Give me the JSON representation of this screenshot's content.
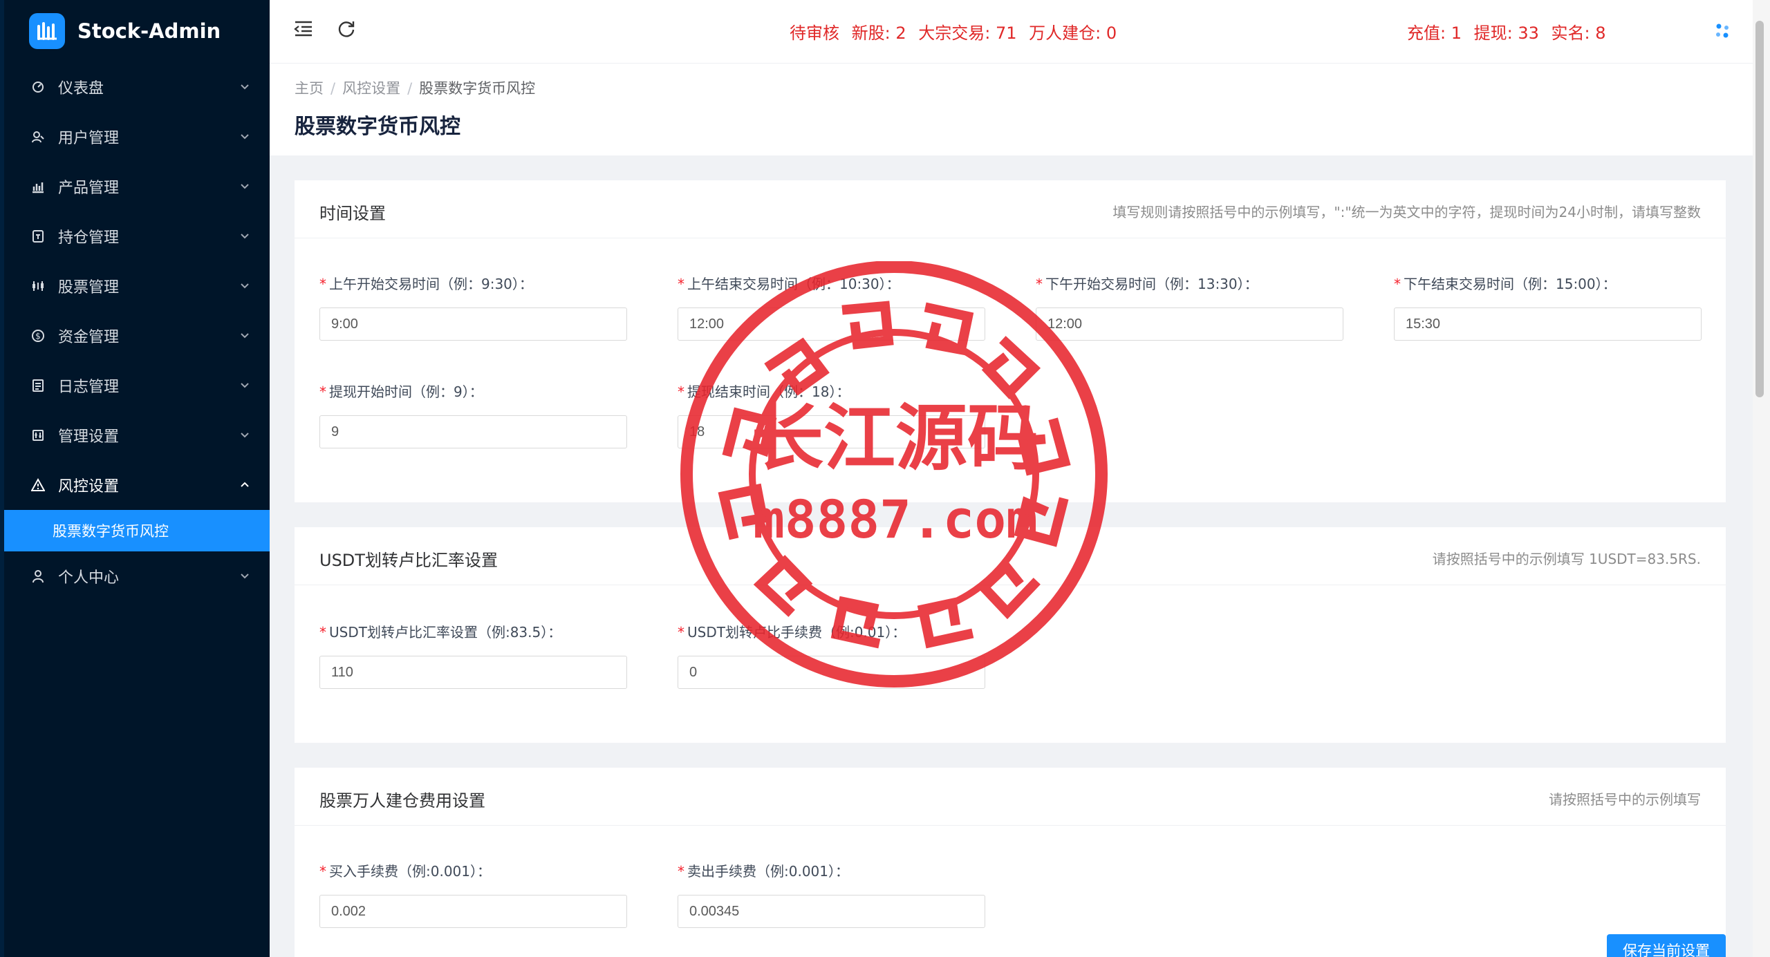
{
  "app": {
    "title": "Stock-Admin"
  },
  "sidebar": {
    "items": [
      {
        "label": "仪表盘",
        "icon": "dashboard-icon"
      },
      {
        "label": "用户管理",
        "icon": "users-icon"
      },
      {
        "label": "产品管理",
        "icon": "chart-icon"
      },
      {
        "label": "持仓管理",
        "icon": "wallet-icon"
      },
      {
        "label": "股票管理",
        "icon": "stock-icon"
      },
      {
        "label": "资金管理",
        "icon": "money-icon"
      },
      {
        "label": "日志管理",
        "icon": "log-icon"
      },
      {
        "label": "管理设置",
        "icon": "settings-icon"
      },
      {
        "label": "风控设置",
        "icon": "warning-icon",
        "expanded": true
      },
      {
        "label": "股票数字货币风控",
        "active": true
      },
      {
        "label": "个人中心",
        "icon": "user-icon"
      }
    ]
  },
  "header": {
    "stats_left": [
      "待审核",
      "新股: 2",
      "大宗交易: 71",
      "万人建仓: 0"
    ],
    "stats_right": [
      "充值: 1",
      "提现: 33",
      "实名: 8"
    ],
    "stat_color": "#e02828"
  },
  "breadcrumb": [
    "主页",
    "风控设置",
    "股票数字货币风控"
  ],
  "page_title": "股票数字货币风控",
  "sections": [
    {
      "title": "时间设置",
      "hint": "填写规则请按照括号中的示例填写，\":\"统一为英文中的字符，提现时间为24小时制，请填写整数",
      "fields": [
        {
          "label": "上午开始交易时间（例：9:30）：",
          "value": "9:00"
        },
        {
          "label": "上午结束交易时间（例：10:30）：",
          "value": "12:00"
        },
        {
          "label": "下午开始交易时间（例：13:30）：",
          "value": "12:00"
        },
        {
          "label": "下午结束交易时间（例：15:00）：",
          "value": "15:30"
        },
        {
          "label": "提现开始时间（例：9）：",
          "value": "9"
        },
        {
          "label": "提现结束时间（例：18）：",
          "value": "18"
        }
      ]
    },
    {
      "title": "USDT划转卢比汇率设置",
      "hint": "请按照括号中的示例填写 1USDT=83.5RS.",
      "fields": [
        {
          "label": "USDT划转卢比汇率设置（例:83.5）：",
          "value": "110"
        },
        {
          "label": "USDT划转卢比手续费（例:0.01）：",
          "value": "0"
        }
      ]
    },
    {
      "title": "股票万人建仓费用设置",
      "hint": "请按照括号中的示例填写",
      "fields": [
        {
          "label": "买入手续费（例:0.001）：",
          "value": "0.002"
        },
        {
          "label": "卖出手续费（例:0.001）：",
          "value": "0.00345"
        }
      ]
    }
  ],
  "save_button": "保存当前设置",
  "watermark": {
    "line1": "长江源码",
    "line2": "m8887.com",
    "color": "#e8262e"
  },
  "colors": {
    "sidebar_bg": "#001529",
    "accent": "#1890ff",
    "required": "#f5222d"
  }
}
